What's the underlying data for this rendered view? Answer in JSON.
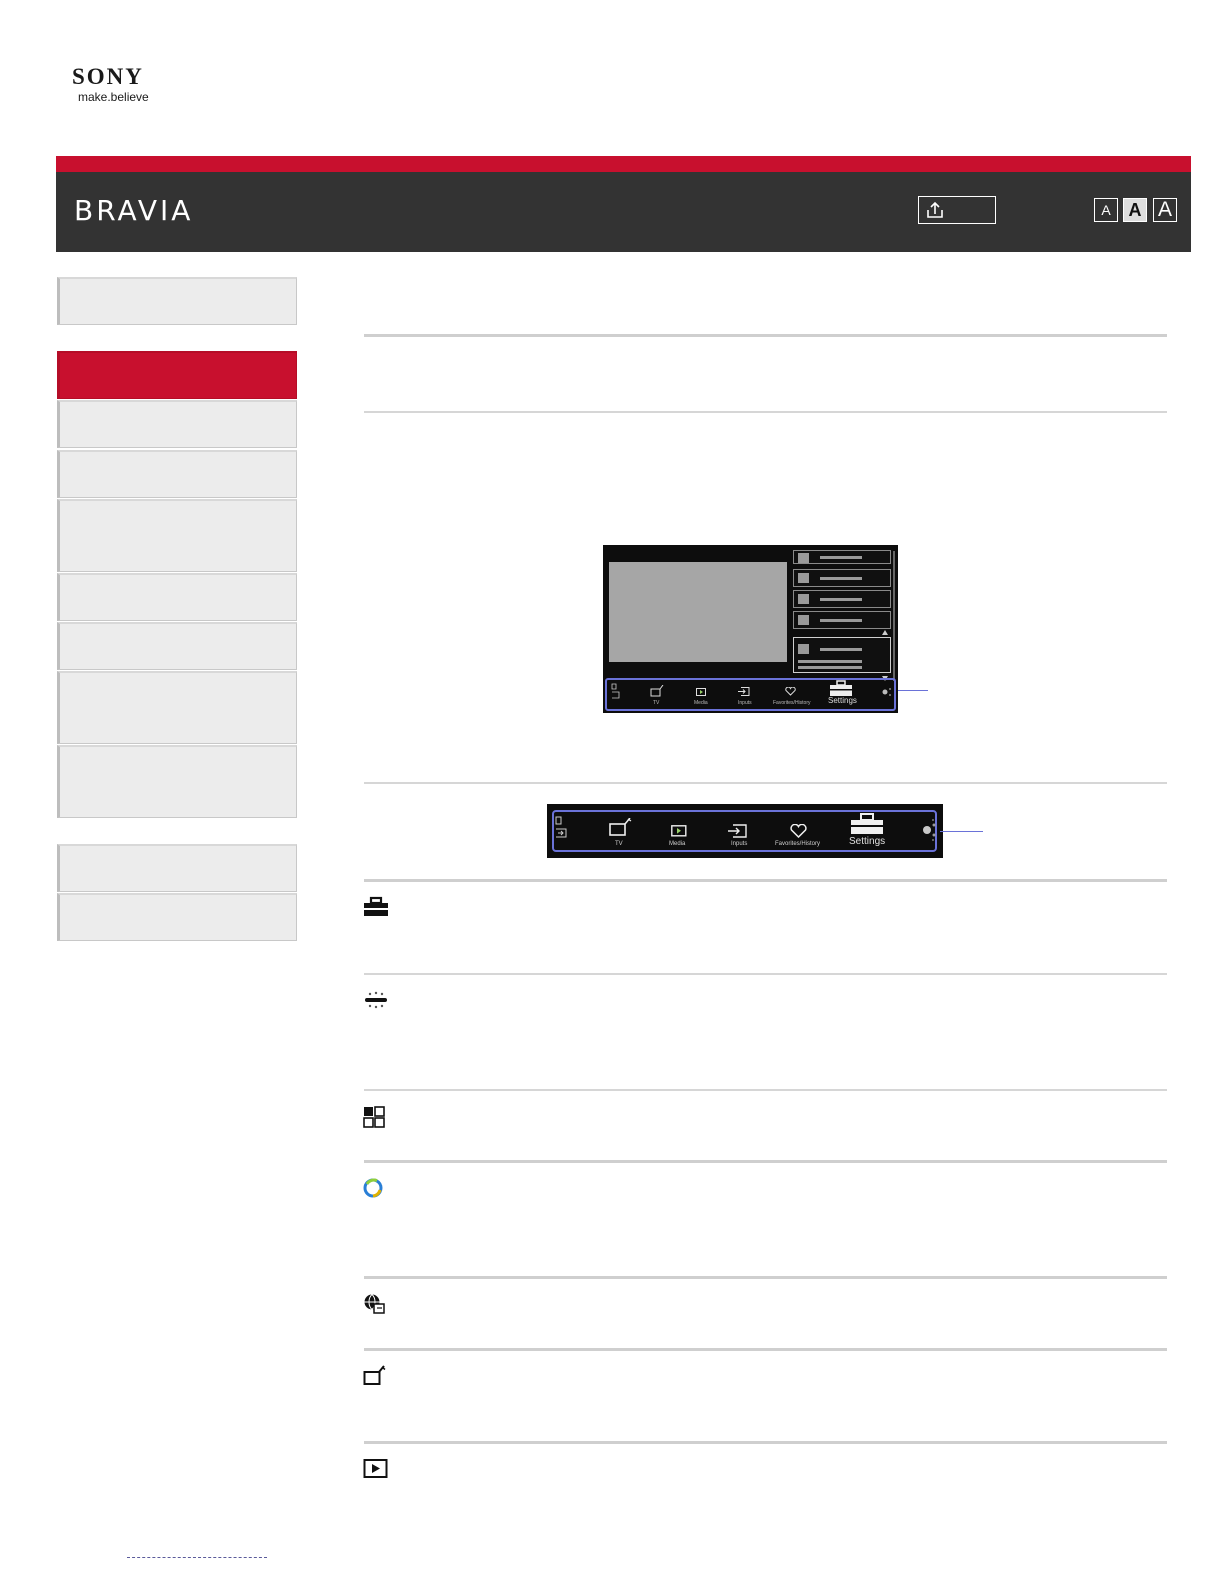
{
  "logo": {
    "brand": "SONY",
    "tagline": "make.believe"
  },
  "header": {
    "product": "BRAVIA"
  },
  "font_size_buttons": [
    {
      "label": "A"
    },
    {
      "label": "A"
    },
    {
      "label": "A"
    }
  ],
  "screen_illustration": {
    "bar_labels": [
      "TV",
      "Media",
      "Inputs",
      "Favorites/History",
      "Settings"
    ]
  },
  "menu_bar_illustration": {
    "labels": [
      "TV",
      "Media",
      "Inputs",
      "Favorites/History",
      "Settings"
    ]
  },
  "icons": [
    "settings-toolbox-icon",
    "connect-icon",
    "apps-icon",
    "sen-icon",
    "internet-icon",
    "tv-icon",
    "media-icon"
  ]
}
